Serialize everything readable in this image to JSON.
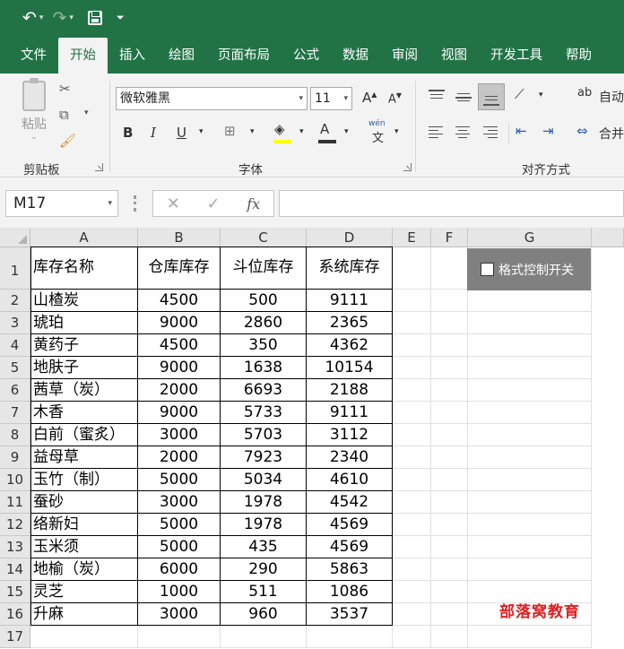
{
  "tabs": [
    "文件",
    "开始",
    "插入",
    "绘图",
    "页面布局",
    "公式",
    "数据",
    "审阅",
    "视图",
    "开发工具",
    "帮助"
  ],
  "active_tab": "开始",
  "ribbon": {
    "paste_label": "粘贴",
    "clipboard_label": "剪贴板",
    "font_label": "字体",
    "align_label": "对齐方式",
    "font_name": "微软雅黑",
    "font_size": "11",
    "wrap_text": "自动",
    "merge": "合并",
    "bold": "B",
    "italic": "I",
    "underline": "U",
    "wen": "wén",
    "wen_char": "文"
  },
  "formula_bar": {
    "name_box": "M17",
    "cancel": "✕",
    "enter": "✓",
    "fx": "fx",
    "value": ""
  },
  "columns": [
    "A",
    "B",
    "C",
    "D",
    "E",
    "F",
    "G"
  ],
  "rows": [
    "1",
    "2",
    "3",
    "4",
    "5",
    "6",
    "7",
    "8",
    "9",
    "10",
    "11",
    "12",
    "13",
    "14",
    "15",
    "16",
    "17"
  ],
  "table": {
    "headers": [
      "库存名称",
      "仓库库存",
      "斗位库存",
      "系统库存"
    ],
    "data": [
      [
        "山楂炭",
        "4500",
        "500",
        "9111"
      ],
      [
        "琥珀",
        "9000",
        "2860",
        "2365"
      ],
      [
        "黄药子",
        "4500",
        "350",
        "4362"
      ],
      [
        "地肤子",
        "9000",
        "1638",
        "10154"
      ],
      [
        "茜草（炭）",
        "2000",
        "6693",
        "2188"
      ],
      [
        "木香",
        "9000",
        "5733",
        "9111"
      ],
      [
        "白前（蜜炙）",
        "3000",
        "5703",
        "3112"
      ],
      [
        "益母草",
        "2000",
        "7923",
        "2340"
      ],
      [
        "玉竹（制）",
        "5000",
        "5034",
        "4610"
      ],
      [
        "蚕砂",
        "3000",
        "1978",
        "4542"
      ],
      [
        "络新妇",
        "5000",
        "1978",
        "4569"
      ],
      [
        "玉米须",
        "5000",
        "435",
        "4569"
      ],
      [
        "地榆（炭）",
        "6000",
        "290",
        "5863"
      ],
      [
        "灵芝",
        "1000",
        "511",
        "1086"
      ],
      [
        "升麻",
        "3000",
        "960",
        "3537"
      ]
    ]
  },
  "checkbox_control": {
    "label": "格式控制开关",
    "checked": false
  },
  "watermark": "部落窝教育"
}
